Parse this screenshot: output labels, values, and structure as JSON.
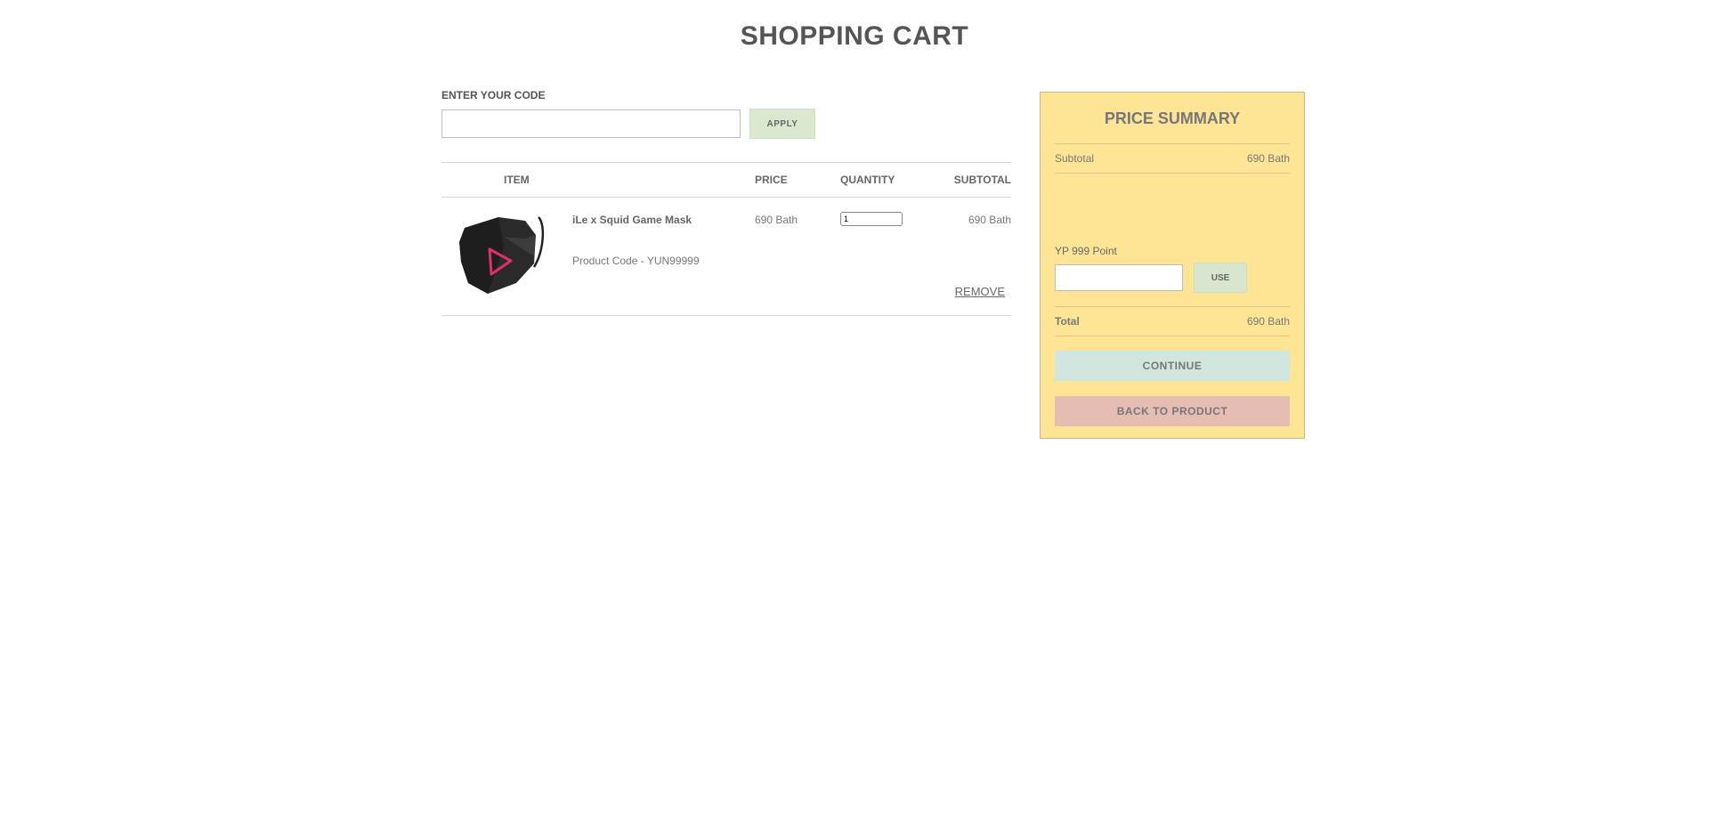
{
  "page": {
    "title": "SHOPPING CART"
  },
  "promo": {
    "label": "ENTER YOUR CODE",
    "code_value": "",
    "apply_label": "APPLY"
  },
  "table": {
    "headers": [
      "ITEM",
      "PRICE",
      "QUANTITY",
      "SUBTOTAL"
    ],
    "items": [
      {
        "name": "iLe x Squid Game Mask",
        "product_code": "Product Code - YUN99999",
        "price": "690 Bath",
        "quantity": "1",
        "subtotal": "690 Bath",
        "remove_label": "REMOVE",
        "image_icon": "face-mask-image"
      }
    ]
  },
  "summary": {
    "title": "PRICE SUMMARY",
    "subtotal_label": "Subtotal",
    "subtotal_value": "690 Bath",
    "points_label": "YP 999 Point",
    "points_value": "",
    "use_label": "USE",
    "total_label": "Total",
    "total_value": "690 Bath",
    "continue_label": "CONTINUE",
    "back_label": "BACK TO PRODUCT"
  },
  "colors": {
    "summary_bg": "#fee596",
    "apply_bg": "#d9e8cf",
    "continue_bg": "#d1e6df",
    "back_bg": "#e5bdb3",
    "mask_accent": "#e0306a"
  }
}
